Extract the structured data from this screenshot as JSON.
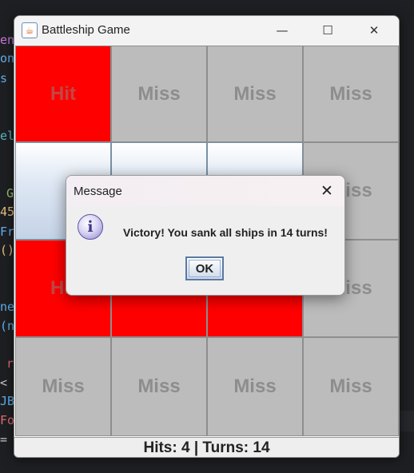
{
  "window": {
    "title": "Battleship Game",
    "controls": {
      "minimize": "—",
      "maximize": "☐",
      "close": "✕"
    }
  },
  "grid": {
    "rows": 4,
    "cols": 4,
    "cells": [
      [
        "Hit",
        "Miss",
        "Miss",
        "Miss"
      ],
      [
        "",
        "",
        "",
        "Miss"
      ],
      [
        "Hit",
        "Hit",
        "Hit",
        "Miss"
      ],
      [
        "Miss",
        "Miss",
        "Miss",
        "Miss"
      ]
    ],
    "colors": {
      "hit": "#ff0000",
      "miss": "#bcbcbc",
      "unrevealed": "#dfe8f4"
    }
  },
  "status": {
    "text": "Hits: 4 | Turns: 14"
  },
  "dialog": {
    "title": "Message",
    "message": "Victory! You sank all ships in 14 turns!",
    "ok_label": "OK",
    "icon": "information-icon",
    "close": "✕"
  },
  "background_code": [
    {
      "text": "en",
      "color": "#c678dd"
    },
    {
      "text": "on",
      "color": "#61afef"
    },
    {
      "text": "s",
      "color": "#61afef"
    },
    {
      "text": "el",
      "color": "#56b6c2"
    },
    {
      "text": "G",
      "color": "#98c379"
    },
    {
      "text": "45",
      "color": "#e5c07b"
    },
    {
      "text": "Fr",
      "color": "#61afef"
    },
    {
      "text": "()",
      "color": "#e5c07b"
    },
    {
      "text": "ne",
      "color": "#61afef"
    },
    {
      "text": "(n",
      "color": "#61afef"
    },
    {
      "text": "r",
      "color": "#e06c75"
    },
    {
      "text": "<",
      "color": "#c8c8c8"
    },
    {
      "text": "JB",
      "color": "#61afef"
    },
    {
      "text": "Fo",
      "color": "#e06c75"
    },
    {
      "text": "=",
      "color": "#c8c8c8"
    }
  ]
}
